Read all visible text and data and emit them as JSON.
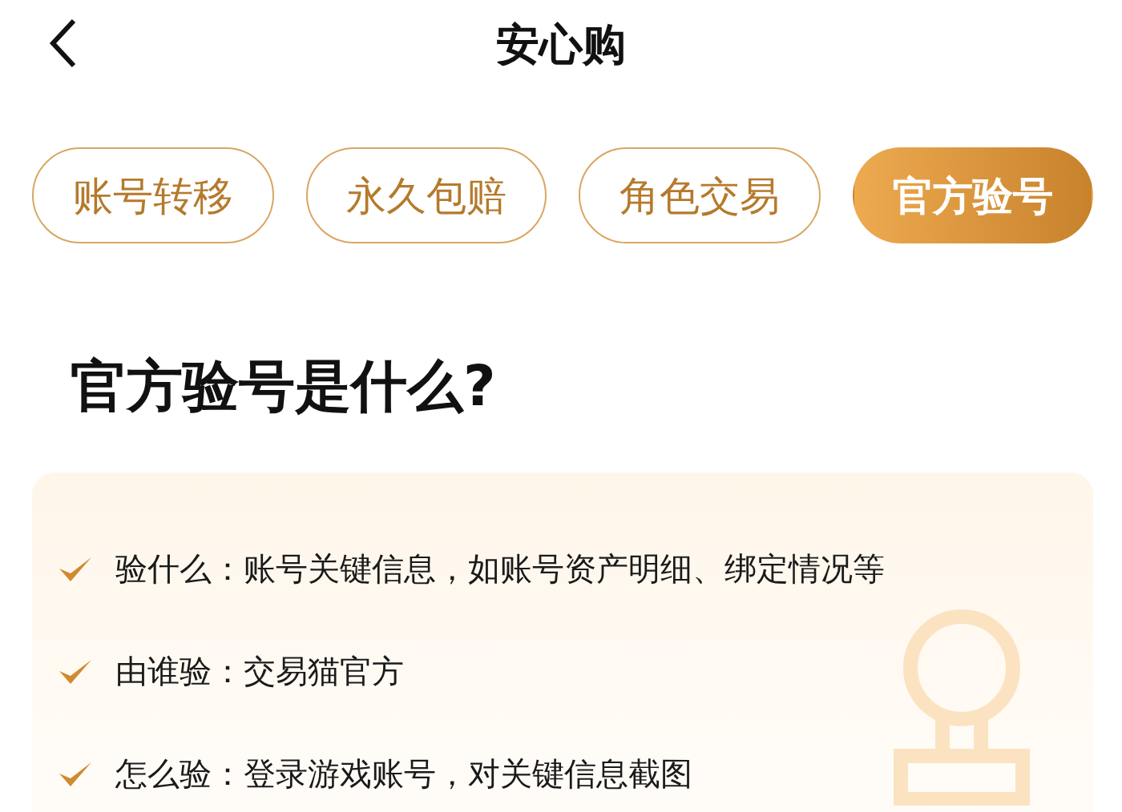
{
  "header": {
    "title": "安心购"
  },
  "tabs": [
    {
      "label": "账号转移",
      "selected": false
    },
    {
      "label": "永久包赔",
      "selected": false
    },
    {
      "label": "角色交易",
      "selected": false
    },
    {
      "label": "官方验号",
      "selected": true
    }
  ],
  "heading": "官方验号是什么?",
  "items": [
    {
      "text": "验什么：账号关键信息，如账号资产明细、绑定情况等"
    },
    {
      "text": "由谁验：交易猫官方"
    },
    {
      "text": "怎么验：登录游戏账号，对关键信息截图"
    }
  ]
}
